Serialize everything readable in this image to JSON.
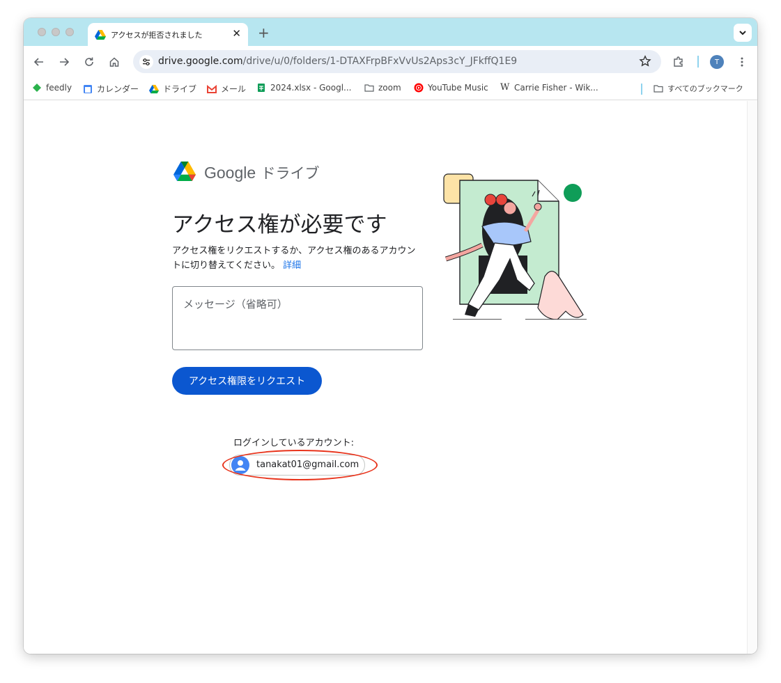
{
  "browser": {
    "tab_title": "アクセスが拒否されました",
    "tab_close": "✕",
    "new_tab": "+",
    "url_host": "drive.google.com",
    "url_path": "/drive/u/0/folders/1-DTAXFrpBFxVvUs2Aps3cY_JFkffQ1E9",
    "profile_initial": "T"
  },
  "bookmarks": [
    {
      "label": "feedly",
      "icon": "feedly-icon"
    },
    {
      "label": "カレンダー",
      "icon": "calendar-icon"
    },
    {
      "label": "ドライブ",
      "icon": "drive-icon"
    },
    {
      "label": "メール",
      "icon": "gmail-icon"
    },
    {
      "label": "2024.xlsx - Googl...",
      "icon": "sheets-icon"
    },
    {
      "label": "zoom",
      "icon": "folder-icon"
    },
    {
      "label": "YouTube Music",
      "icon": "youtube-music-icon"
    },
    {
      "label": "Carrie Fisher - Wik...",
      "icon": "wikipedia-icon"
    }
  ],
  "all_bookmarks": "すべてのブックマーク",
  "page": {
    "logo_google": "Google",
    "logo_product": "ドライブ",
    "heading": "アクセス権が必要です",
    "description": "アクセス権をリクエストするか、アクセス権のあるアカウントに切り替えてください。",
    "details_link": "詳細",
    "message_placeholder": "メッセージ（省略可）",
    "request_button": "アクセス権限をリクエスト",
    "signed_in_label": "ログインしているアカウント:",
    "account_email": "tanakat01@gmail.com"
  },
  "colors": {
    "tabstrip": "#b7e6f0",
    "primary_button": "#0b57d0",
    "link": "#1a73e8",
    "annotation_ellipse": "#e8341c"
  }
}
